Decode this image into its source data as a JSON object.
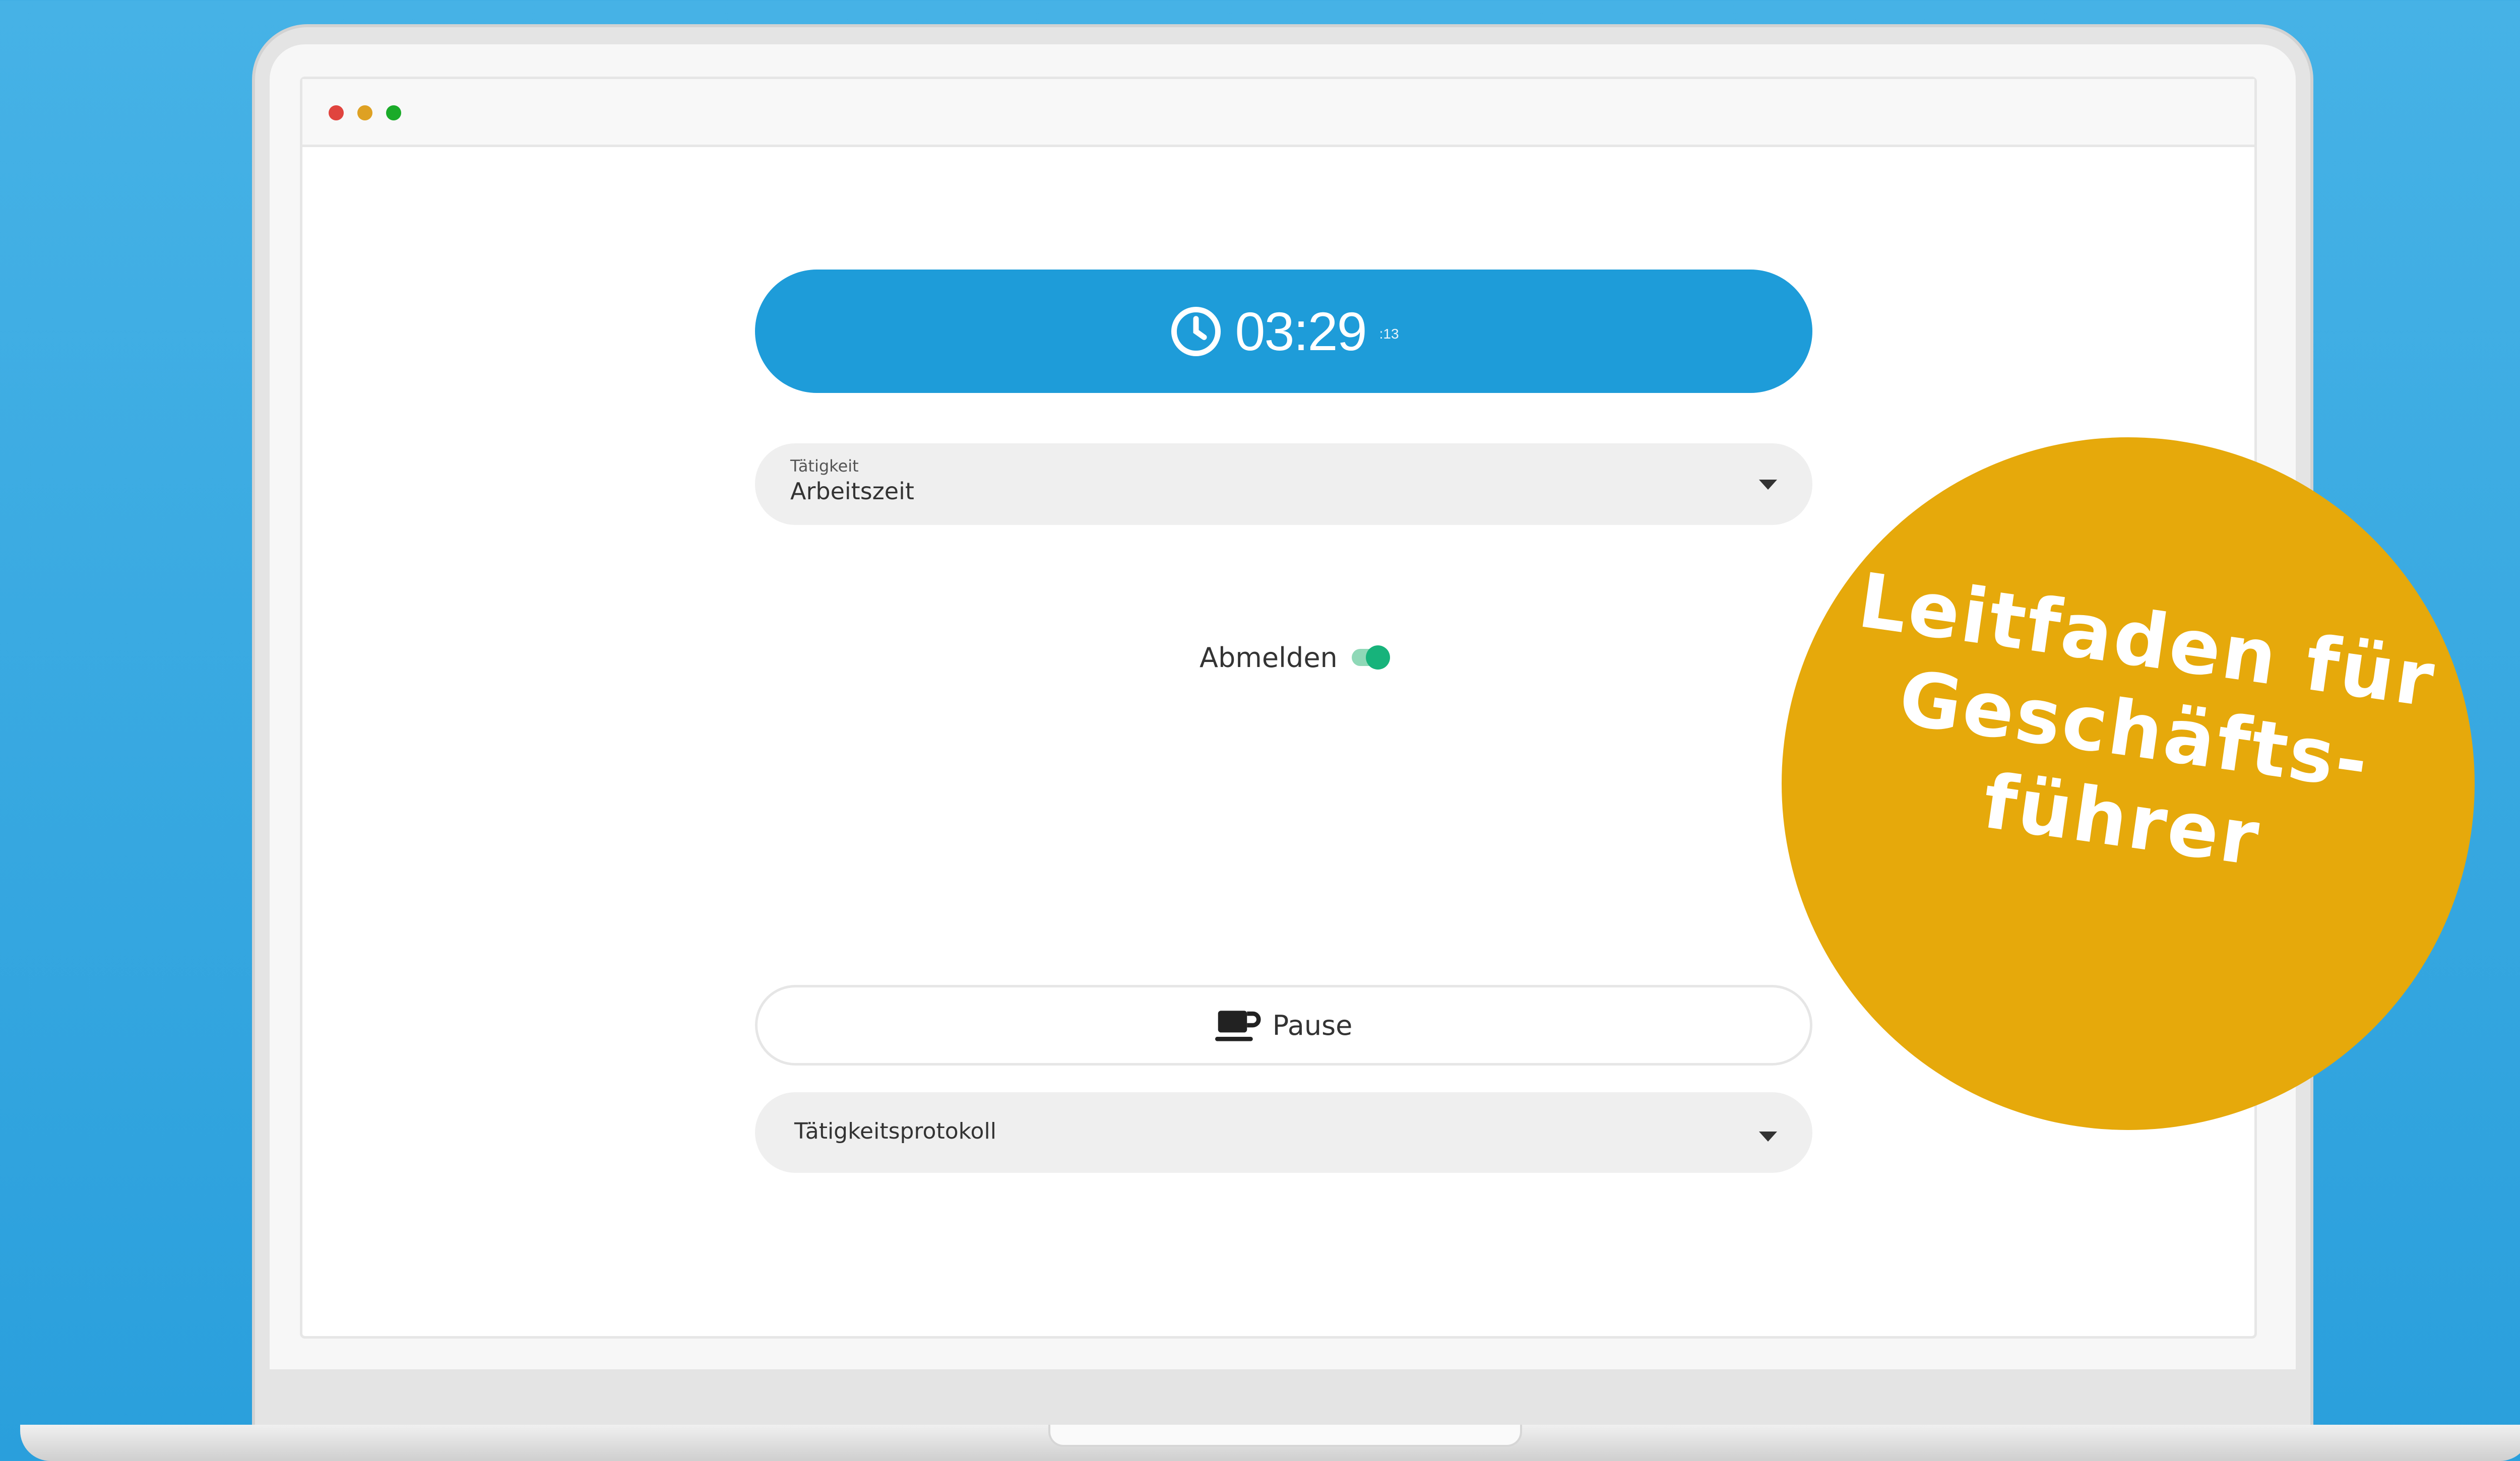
{
  "timer": {
    "time": "03:29",
    "seconds": ":13",
    "icon": "clock-icon"
  },
  "activity": {
    "label": "Tätigkeit",
    "value": "Arbeitszeit"
  },
  "logout_toggle": {
    "label": "Abmelden",
    "state": "on"
  },
  "pause": {
    "label": "Pause",
    "icon": "coffee-cup-icon"
  },
  "activity_log": {
    "label": "Tätigkeitsprotokoll"
  },
  "badge": {
    "line1": "Leitfaden für",
    "line2": "Geschäfts-",
    "line3": "führer"
  },
  "colors": {
    "primary": "#1e9cd9",
    "toggle": "#17b37b",
    "badge": "#e6a90b",
    "background": "#2a9fdc",
    "window_dots": [
      "#e0443e",
      "#dea123",
      "#1aab29"
    ]
  }
}
